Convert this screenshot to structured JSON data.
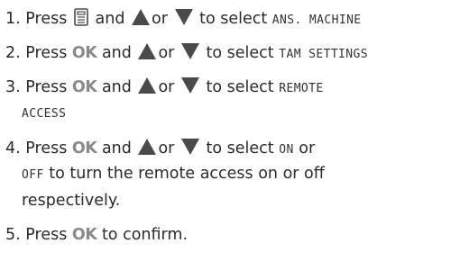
{
  "steps": [
    {
      "number": "1.",
      "press": "Press",
      "and": "and",
      "or": "or",
      "to_select": "to select",
      "lcd": "ANS. MACHINE",
      "icons": [
        "menu-icon",
        "up-arrow-icon",
        "down-arrow-icon"
      ]
    },
    {
      "number": "2.",
      "press": "Press",
      "key": "OK",
      "and": "and",
      "or": "or",
      "to_select": "to select",
      "lcd": "TAM SETTINGS",
      "icons": [
        "up-arrow-icon",
        "down-arrow-icon"
      ]
    },
    {
      "number": "3.",
      "press": "Press",
      "key": "OK",
      "and": "and",
      "or": "or",
      "to_select": "to select",
      "lcd_line1": "REMOTE",
      "lcd_line2": "ACCESS",
      "icons": [
        "up-arrow-icon",
        "down-arrow-icon"
      ]
    },
    {
      "number": "4.",
      "press": "Press",
      "key": "OK",
      "and": "and",
      "or": "or",
      "to_select": "to select",
      "lcd_on": "ON",
      "or2": "or",
      "lcd_off": "OFF",
      "rest_line2": "to turn the remote access on or off",
      "rest_line3": "respectively.",
      "icons": [
        "up-arrow-icon",
        "down-arrow-icon"
      ]
    },
    {
      "number": "5.",
      "press": "Press",
      "key": "OK",
      "rest": "to confirm."
    }
  ],
  "colors": {
    "text": "#2b2b2b",
    "key_grey": "#8a8a8a",
    "arrow_fill": "#4a4a4a"
  }
}
